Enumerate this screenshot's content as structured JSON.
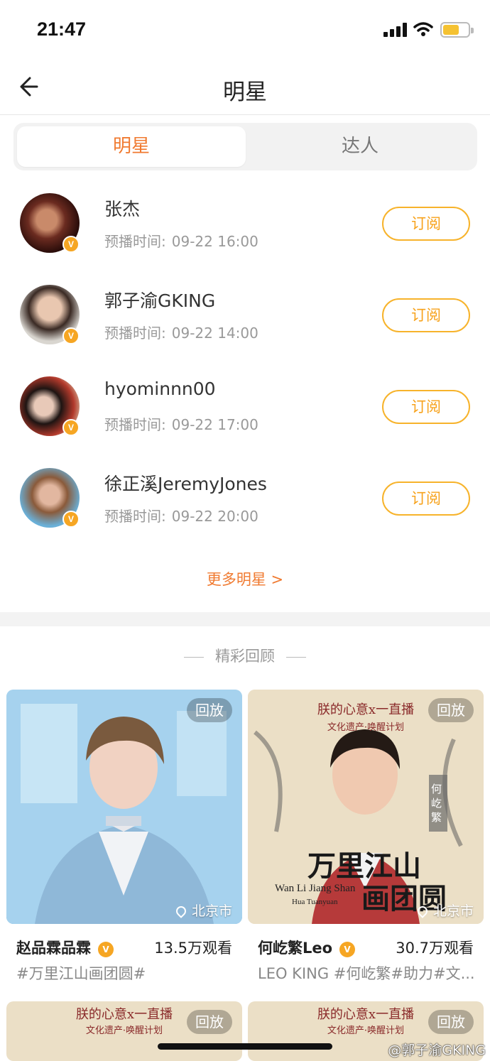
{
  "status_bar": {
    "time": "21:47"
  },
  "nav": {
    "title": "明星"
  },
  "tabs": [
    {
      "label": "明星",
      "active": true
    },
    {
      "label": "达人",
      "active": false
    }
  ],
  "stars": [
    {
      "name": "张杰",
      "time_label": "预播时间:",
      "time": "09-22 16:00",
      "subscribe": "订阅"
    },
    {
      "name": "郭子渝GKING",
      "time_label": "预播时间:",
      "time": "09-22 14:00",
      "subscribe": "订阅"
    },
    {
      "name": "hyominnn00",
      "time_label": "预播时间:",
      "time": "09-22 17:00",
      "subscribe": "订阅"
    },
    {
      "name": "徐正溪JeremyJones",
      "time_label": "预播时间:",
      "time": "09-22 20:00",
      "subscribe": "订阅"
    }
  ],
  "more_stars": "更多明星 >",
  "section_title": "精彩回顾",
  "cards": [
    {
      "tag": "回放",
      "location": "北京市",
      "author": "赵品霖品霖",
      "verified": "V",
      "views": "13.5万观看",
      "desc": "#万里江山画团圆#"
    },
    {
      "tag": "回放",
      "location": "北京市",
      "author": "何屹繁Leo",
      "verified": "V",
      "views": "30.7万观看",
      "desc": "LEO KING #何屹繁#助力#文..."
    },
    {
      "tag": "回放"
    },
    {
      "tag": "回放"
    }
  ],
  "poster_text": {
    "top": "朕的心意x一直播",
    "banner": "文化遗产·唤醒计划",
    "side": "何屹繁",
    "big1": "万里江山",
    "big2": "画团圆",
    "en1": "Wan Li Jiang Shan",
    "en2": "Hua Tuanyuan"
  },
  "verified_badge": "V",
  "watermark": "@郭子渝GKING",
  "colors": {
    "accent": "#f07a30",
    "subscribe": "#f7b32b",
    "verified": "#f6a623"
  }
}
